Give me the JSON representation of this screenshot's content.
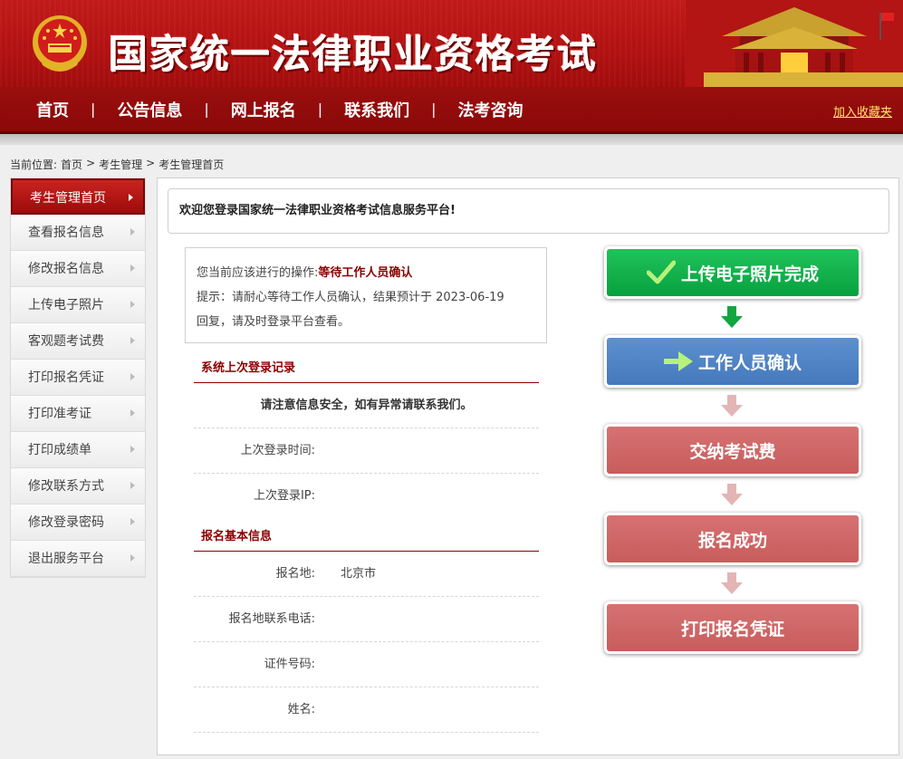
{
  "header": {
    "site_title": "国家统一法律职业资格考试"
  },
  "nav": {
    "items": [
      "首页",
      "公告信息",
      "网上报名",
      "联系我们",
      "法考咨询"
    ],
    "separator": "|",
    "favorite_link": "加入收藏夹"
  },
  "breadcrumb": {
    "prefix": "当前位置:",
    "items": [
      "首页",
      "考生管理",
      "考生管理首页"
    ],
    "sep": ">"
  },
  "sidebar": {
    "items": [
      {
        "label": "考生管理首页",
        "active": true
      },
      {
        "label": "查看报名信息"
      },
      {
        "label": "修改报名信息"
      },
      {
        "label": "上传电子照片"
      },
      {
        "label": "客观题考试费"
      },
      {
        "label": "打印报名凭证"
      },
      {
        "label": "打印准考证"
      },
      {
        "label": "打印成绩单"
      },
      {
        "label": "修改联系方式"
      },
      {
        "label": "修改登录密码"
      },
      {
        "label": "退出服务平台"
      }
    ]
  },
  "main": {
    "welcome": "欢迎您登录国家统一法律职业资格考试信息服务平台!",
    "operation": {
      "label": "您当前应该进行的操作:",
      "status": "等待工作人员确认",
      "hint_line1": "提示：请耐心等待工作人员确认，结果预计于 2023-06-19",
      "hint_line2": "回复，请及时登录平台查看。"
    },
    "login_record": {
      "title": "系统上次登录记录",
      "notice": "请注意信息安全，如有异常请联系我们。",
      "last_time_label": "上次登录时间:",
      "last_time_value": "",
      "last_ip_label": "上次登录IP:",
      "last_ip_value": ""
    },
    "basic_info": {
      "title": "报名基本信息",
      "location_label": "报名地:",
      "location_value": "北京市",
      "phone_label": "报名地联系电话:",
      "phone_value": "",
      "id_label": "证件号码:",
      "id_value": "",
      "name_label": "姓名:",
      "name_value": ""
    }
  },
  "flow": {
    "steps": [
      {
        "label": "上传电子照片完成",
        "state": "done",
        "icon": "check-icon"
      },
      {
        "label": "工作人员确认",
        "state": "current",
        "icon": "arrow-right-icon"
      },
      {
        "label": "交纳考试费",
        "state": "pending"
      },
      {
        "label": "报名成功",
        "state": "pending"
      },
      {
        "label": "打印报名凭证",
        "state": "pending"
      }
    ],
    "colors": {
      "done": "#0aa543",
      "current": "#4a7fc1",
      "pending": "#cb6262",
      "arrow_active": "#12a640",
      "arrow_pending": "#e3b5b5"
    }
  }
}
